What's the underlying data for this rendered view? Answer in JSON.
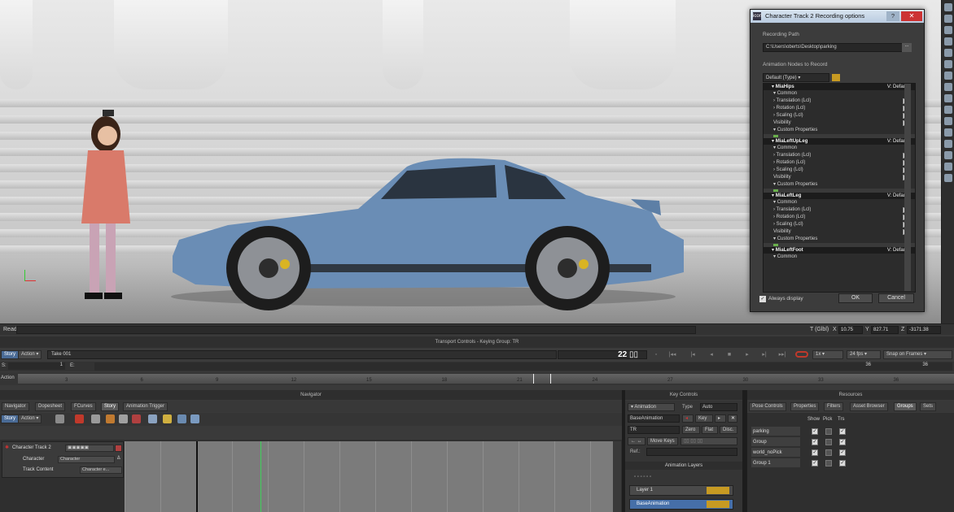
{
  "dialog": {
    "title": "Character Track 2 Recording options",
    "app_icon": "icon",
    "recording_path_label": "Recording Path",
    "recording_path": "C:\\Users\\oberts\\Desktop\\parking",
    "path_btn": "...",
    "nodes_label": "Animation Nodes to Record",
    "nodes_dropdown": "Default (Type)",
    "always_display": "Always display",
    "ok": "OK",
    "cancel": "Cancel",
    "nodes": [
      {
        "name": "MiaHips",
        "v": "V: Default",
        "common": "Common",
        "translation": "Translation (Lcl)",
        "rotation": "Rotation (Lcl)",
        "scaling": "Scaling (Lcl)",
        "visibility": "Visibility",
        "custom": "Custom Properties"
      },
      {
        "name": "MiaLeftUpLeg",
        "v": "V: Default",
        "common": "Common",
        "translation": "Translation (Lcl)",
        "rotation": "Rotation (Lcl)",
        "scaling": "Scaling (Lcl)",
        "visibility": "Visibility",
        "custom": "Custom Properties"
      },
      {
        "name": "MiaLeftLeg",
        "v": "V: Default",
        "common": "Common",
        "translation": "Translation (Lcl)",
        "rotation": "Rotation (Lcl)",
        "scaling": "Scaling (Lcl)",
        "visibility": "Visibility",
        "custom": "Custom Properties"
      },
      {
        "name": "MiaLeftFoot",
        "v": "V: Default",
        "common": "Common"
      }
    ]
  },
  "status": {
    "text": "Ready",
    "coord_label": "T (Glbl)",
    "x_label": "X",
    "x": "10.75",
    "y_label": "Y",
    "y": "827.71",
    "z_label": "Z",
    "z": "-3171.38"
  },
  "transport": {
    "title": "Transport Controls - Keying Group: TR",
    "story": "Story",
    "action": "Action",
    "take": "Take 001",
    "frame": "22",
    "speed": "1x",
    "fps": "24 fps",
    "snap": "Snap on Frames",
    "start_label": "S:",
    "start": "1",
    "end_label": "E:",
    "end": "36",
    "end_right": "36",
    "action_label": "Action",
    "ticks": [
      "3",
      "6",
      "9",
      "12",
      "15",
      "18",
      "21",
      "24",
      "27",
      "30",
      "33",
      "36"
    ]
  },
  "navigator": {
    "title": "Navigator",
    "tabs": [
      "Navigator",
      "Dopesheet",
      "FCurves",
      "Story",
      "Animation Trigger"
    ],
    "active_tab": 3,
    "story_btn": "Story",
    "action_btn": "Action",
    "track_name": "Character Track 2",
    "character_label": "Character",
    "character_value": "Character",
    "content_label": "Track Content",
    "content_value": "Character e..."
  },
  "key_controls": {
    "title": "Key Controls",
    "animation": "Animation",
    "type_label": "Type",
    "type_value": "Auto",
    "base_anim": "BaseAnimation",
    "key": "Key",
    "tr": "TR",
    "zero": "Zero",
    "flat": "Flat",
    "disc": "Disc.",
    "move_keys": "Move Keys",
    "ref_label": "Ref.:",
    "layers_title": "Animation Layers",
    "layers": [
      "Layer 1",
      "BaseAnimation"
    ]
  },
  "resources": {
    "title": "Resources",
    "tabs": [
      "Pose Controls",
      "Properties",
      "Filters",
      "Asset Browser",
      "Groups",
      "Sets"
    ],
    "active_tab": 4,
    "cols": [
      "Show",
      "Pick",
      "Trs"
    ],
    "groups": [
      {
        "name": "parking",
        "show": true,
        "pick": false,
        "trs": true
      },
      {
        "name": "Group",
        "show": true,
        "pick": false,
        "trs": true
      },
      {
        "name": "world_noPick",
        "show": true,
        "pick": false,
        "trs": true
      },
      {
        "name": "Group 1",
        "show": true,
        "pick": false,
        "trs": true
      }
    ]
  },
  "colors": {
    "accent": "#4a6b96",
    "record": "#c0392b",
    "playhead": "#3fd05a"
  }
}
